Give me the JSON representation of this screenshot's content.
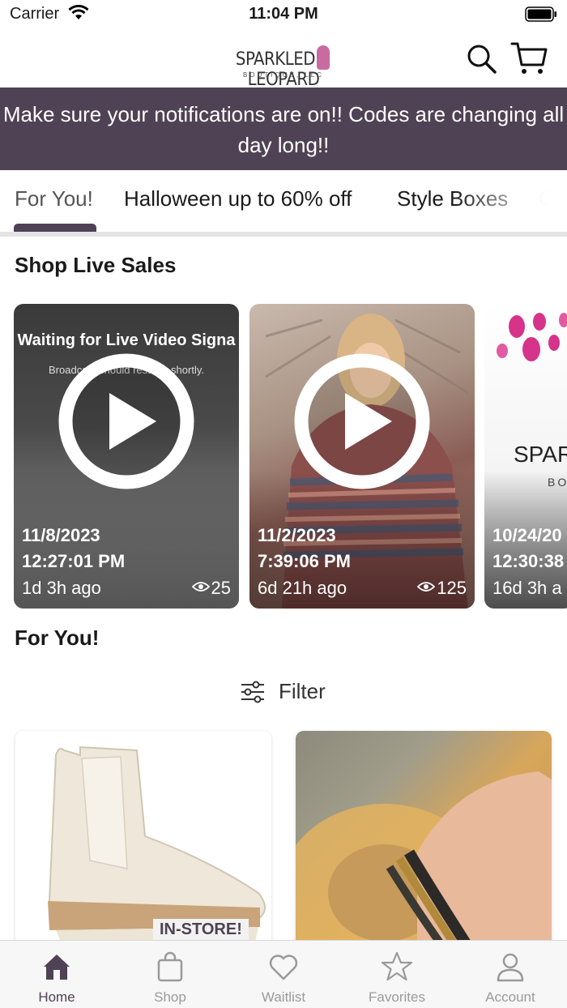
{
  "status_bar": {
    "carrier": "Carrier",
    "time": "11:04 PM"
  },
  "header": {
    "logo_left": "SPARKLED",
    "logo_right": "LEOPARD",
    "logo_sub": "BOUTIQUE, LLC"
  },
  "banner": {
    "text": "Make sure your notifications are on!! Codes are changing all day long!!"
  },
  "tabs": [
    {
      "label": "For You!"
    },
    {
      "label": "Halloween up to 60% off"
    },
    {
      "label": "Style Boxes"
    },
    {
      "label": "C"
    }
  ],
  "live_section": {
    "title": "Shop Live Sales",
    "cards": [
      {
        "overlay_title": "Waiting for Live Video Signa",
        "overlay_sub": "Broadcast should resume shortly.",
        "date": "11/8/2023",
        "time": "12:27:01 PM",
        "ago": "1d 3h ago",
        "views": "25"
      },
      {
        "date": "11/2/2023",
        "time": "7:39:06 PM",
        "ago": "6d 21h ago",
        "views": "125"
      },
      {
        "logo_text": "SPARKLE",
        "logo_sub": "BO",
        "date": "10/24/20",
        "time": "12:30:38",
        "ago": "16d 3h a"
      }
    ]
  },
  "for_you": {
    "title": "For You!",
    "filter_label": "Filter",
    "products": [
      {
        "badge": "IN-STORE!"
      },
      {}
    ]
  },
  "bottom_nav": [
    {
      "label": "Home",
      "icon": "home-icon"
    },
    {
      "label": "Shop",
      "icon": "shopping-bag-icon"
    },
    {
      "label": "Waitlist",
      "icon": "heart-icon"
    },
    {
      "label": "Favorites",
      "icon": "star-icon"
    },
    {
      "label": "Account",
      "icon": "account-icon"
    }
  ],
  "colors": {
    "brand": "#4f4254",
    "inactive": "#9a9a9a",
    "banner_text": "#ffffff"
  }
}
